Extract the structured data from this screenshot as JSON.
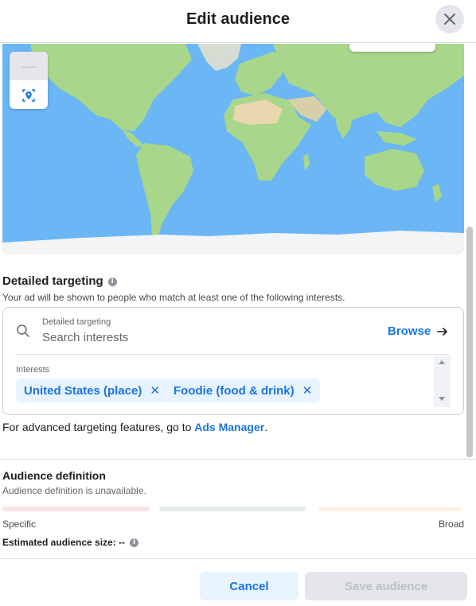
{
  "header": {
    "title": "Edit audience"
  },
  "map": {
    "zoom_out_symbol": "—",
    "ocean_color": "#6bb6f5",
    "land_color": "#a8d68a"
  },
  "detailed_targeting": {
    "title": "Detailed targeting",
    "description": "Your ad will be shown to people who match at least one of the following interests.",
    "search_label": "Detailed targeting",
    "search_placeholder": "Search interests",
    "browse_label": "Browse",
    "interests_label": "Interests",
    "interests": [
      {
        "label": "United States (place)"
      },
      {
        "label": "Foodie (food & drink)"
      }
    ]
  },
  "advanced": {
    "text": "For advanced targeting features, go to ",
    "link": "Ads Manager",
    "suffix": "."
  },
  "audience_definition": {
    "title": "Audience definition",
    "description": "Audience definition is unavailable.",
    "scale_left": "Specific",
    "scale_right": "Broad",
    "estimated_size": "Estimated audience size: --"
  },
  "footer": {
    "cancel_label": "Cancel",
    "save_label": "Save audience"
  },
  "colors": {
    "accent": "#1b74e4",
    "chip_bg": "#e7f3ff",
    "disabled_bg": "#e4e6eb"
  }
}
